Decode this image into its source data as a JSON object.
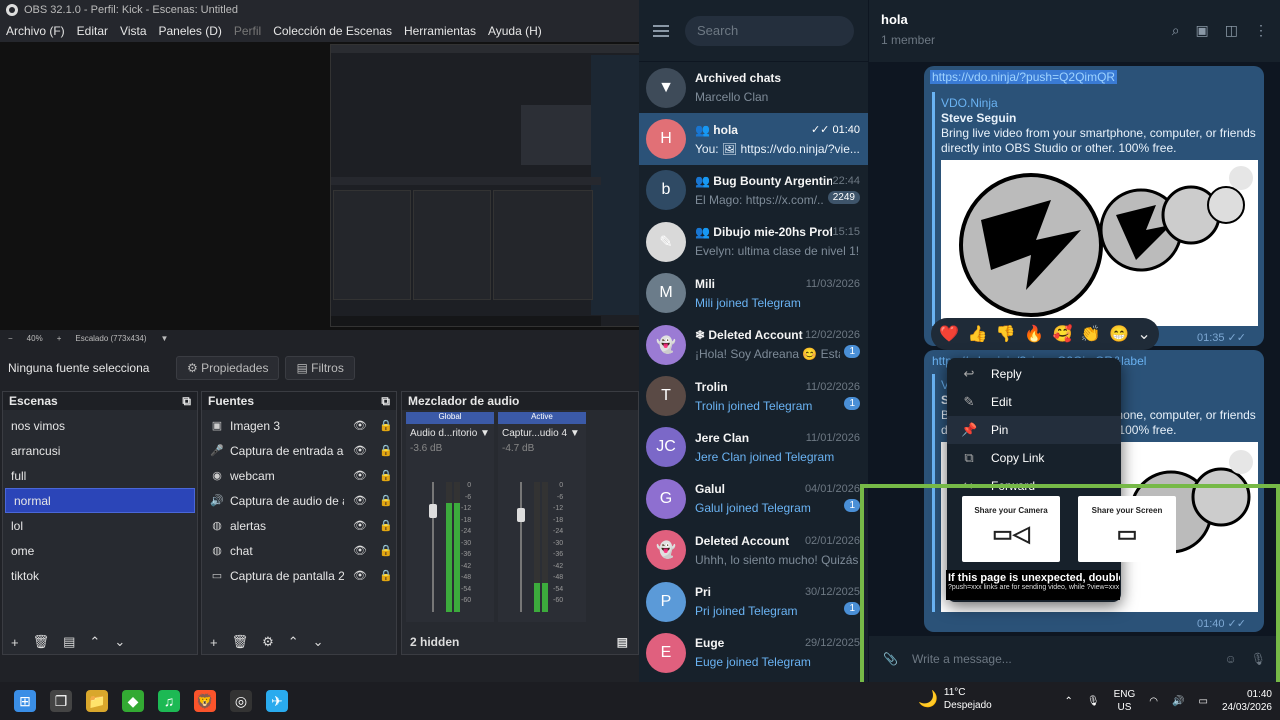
{
  "obs": {
    "title": "OBS 32.1.0 - Perfil: Kick - Escenas: Untitled",
    "menu": [
      "Archivo (F)",
      "Editar",
      "Vista",
      "Paneles (D)",
      "Perfil",
      "Colección de Escenas",
      "Herramientas",
      "Ayuda (H)"
    ],
    "zoom": {
      "minus": "−",
      "value": "40%",
      "plus": "+",
      "scale": "Escalado (773x434)"
    },
    "no_source": "Ninguna fuente selecciona",
    "properties": "Propiedades",
    "filters": "Filtros",
    "scenes_title": "Escenas",
    "scenes": [
      "nos vimos",
      "arrancusi",
      "full",
      "normal",
      "lol",
      "ome",
      "tiktok"
    ],
    "selected_scene": "normal",
    "sources_title": "Fuentes",
    "sources": [
      {
        "icon": "image-icon",
        "glyph": "▣",
        "name": "Imagen 3"
      },
      {
        "icon": "mic-icon",
        "glyph": "🎤",
        "name": "Captura de entrada aud"
      },
      {
        "icon": "camera-icon",
        "glyph": "◉",
        "name": "webcam"
      },
      {
        "icon": "audio-output-icon",
        "glyph": "🔊",
        "name": "Captura de audio de apl"
      },
      {
        "icon": "globe-icon",
        "glyph": "◍",
        "name": "alertas"
      },
      {
        "icon": "globe-icon",
        "glyph": "◍",
        "name": "chat"
      },
      {
        "icon": "monitor-icon",
        "glyph": "▭",
        "name": "Captura de pantalla 2"
      }
    ],
    "mixer_title": "Mezclador de audio",
    "mixer": [
      {
        "header": "Global",
        "name": "Audio d...ritorio",
        "db": "-3.6 dB"
      },
      {
        "header": "Active",
        "name": "Captur...udio 4",
        "db": "-4.7 dB"
      }
    ],
    "mixer_scale": [
      "0",
      "-6",
      "-12",
      "-18",
      "-24",
      "-30",
      "-36",
      "-42",
      "-48",
      "-54",
      "-60"
    ],
    "hidden": "2 hidden"
  },
  "telegram": {
    "search_placeholder": "Search",
    "chats": [
      {
        "name": "Archived chats",
        "msg": "Marcello Clan",
        "time": "",
        "badge": "",
        "avatar": "▼",
        "color": "#3e4b59"
      },
      {
        "name": "hola",
        "msg": "You: 🖼 https://vdo.ninja/?vie...",
        "time": "✓✓ 01:40",
        "badge": "",
        "avatar": "H",
        "color": "#e17076",
        "group": "true"
      },
      {
        "name": "Bug Bounty Argentina",
        "msg": "El Mago: https://x.com/...",
        "time": "22:44",
        "badge": "2249",
        "avatar": "b",
        "color": "#2f4a64",
        "group": "true"
      },
      {
        "name": "Dibujo mie-20hs Prof...",
        "msg": "Evelyn: ultima clase de nivel 1!",
        "time": "15:15",
        "badge": "",
        "avatar": "✎",
        "color": "#d9d9d9",
        "group": "true"
      },
      {
        "name": "Mili",
        "msg": "Mili joined Telegram",
        "time": "11/03/2026",
        "badge": "",
        "avatar": "M",
        "color": "#6b7c8a"
      },
      {
        "name": "❄ Deleted Account",
        "msg": "¡Hola! Soy Adreana 😊 Esta...",
        "time": "12/02/2026",
        "badge": "1",
        "avatar": "👻",
        "color": "#9b7bd4"
      },
      {
        "name": "Trolin",
        "msg": "Trolin joined Telegram",
        "time": "11/02/2026",
        "badge": "1",
        "avatar": "T",
        "color": "#5a4a45"
      },
      {
        "name": "Jere Clan",
        "msg": "Jere Clan joined Telegram",
        "time": "11/01/2026",
        "badge": "",
        "avatar": "JC",
        "color": "#7b68c8"
      },
      {
        "name": "Galul",
        "msg": "Galul joined Telegram",
        "time": "04/01/2026",
        "badge": "1",
        "avatar": "G",
        "color": "#8e6fd0"
      },
      {
        "name": "Deleted Account",
        "msg": "Uhhh, lo siento mucho! Quizás ...",
        "time": "02/01/2026",
        "badge": "",
        "avatar": "👻",
        "color": "#e0607e"
      },
      {
        "name": "Pri",
        "msg": "Pri joined Telegram",
        "time": "30/12/2025",
        "badge": "1",
        "avatar": "P",
        "color": "#5b9ad8"
      },
      {
        "name": "Euge",
        "msg": "Euge joined Telegram",
        "time": "29/12/2025",
        "badge": "",
        "avatar": "E",
        "color": "#e0607e"
      }
    ],
    "header": {
      "title": "hola",
      "sub": "1 member"
    },
    "msg1": {
      "link": "https://vdo.ninja/?push=Q2QimQR",
      "site": "VDO.Ninja",
      "title": "Steve Seguin",
      "desc": "Bring live video from your smartphone, computer, or friends directly into OBS Studio or other. 100% free.",
      "time": "01:35 ✓✓"
    },
    "msg2": {
      "link": "https://vdo.ninja/?view=Q2QimQR&label",
      "site": "VDO.Ninja",
      "title": "Steve Seguin",
      "desc": "Bring live video from your smartphone, computer, or friends directly into OBS Studio or other. 100% free.",
      "time": "01:40 ✓✓"
    },
    "reactions": [
      "❤️",
      "👍",
      "👎",
      "🔥",
      "🥰",
      "👏",
      "😁",
      "⌄"
    ],
    "context": [
      {
        "icon": "reply-icon",
        "glyph": "↩",
        "label": "Reply"
      },
      {
        "icon": "edit-icon",
        "glyph": "✎",
        "label": "Edit"
      },
      {
        "icon": "pin-icon",
        "glyph": "📌",
        "label": "Pin"
      },
      {
        "icon": "copy-link-icon",
        "glyph": "⧉",
        "label": "Copy Link"
      },
      {
        "icon": "forward-icon",
        "glyph": "↪",
        "label": "Forward"
      }
    ],
    "composer": "Write a message..."
  },
  "vdo": {
    "camera": "Share your Camera",
    "screen": "Share your Screen",
    "msg": "If this page is unexpected, double check your link.",
    "sub": "?push=xxx links are for sending video, while ?view=xxx are for viewing."
  },
  "taskbar": {
    "temp": "11°C",
    "weather": "Despejado",
    "lang1": "ENG",
    "lang2": "US",
    "time": "01:40",
    "date": "24/03/2026",
    "apps": [
      {
        "icon": "windows-icon",
        "glyph": "⊞",
        "color": "#3a8ee6"
      },
      {
        "icon": "task-view-icon",
        "glyph": "❐",
        "color": "#444"
      },
      {
        "icon": "explorer-icon",
        "glyph": "📁",
        "color": "#d9a72c"
      },
      {
        "icon": "git-icon",
        "glyph": "◆",
        "color": "#3a3"
      },
      {
        "icon": "spotify-icon",
        "glyph": "♫",
        "color": "#1db954"
      },
      {
        "icon": "brave-icon",
        "glyph": "🦁",
        "color": "#fb542b"
      },
      {
        "icon": "obs-icon",
        "glyph": "◎",
        "color": "#333"
      },
      {
        "icon": "telegram-icon",
        "glyph": "✈",
        "color": "#2aabee"
      }
    ]
  }
}
